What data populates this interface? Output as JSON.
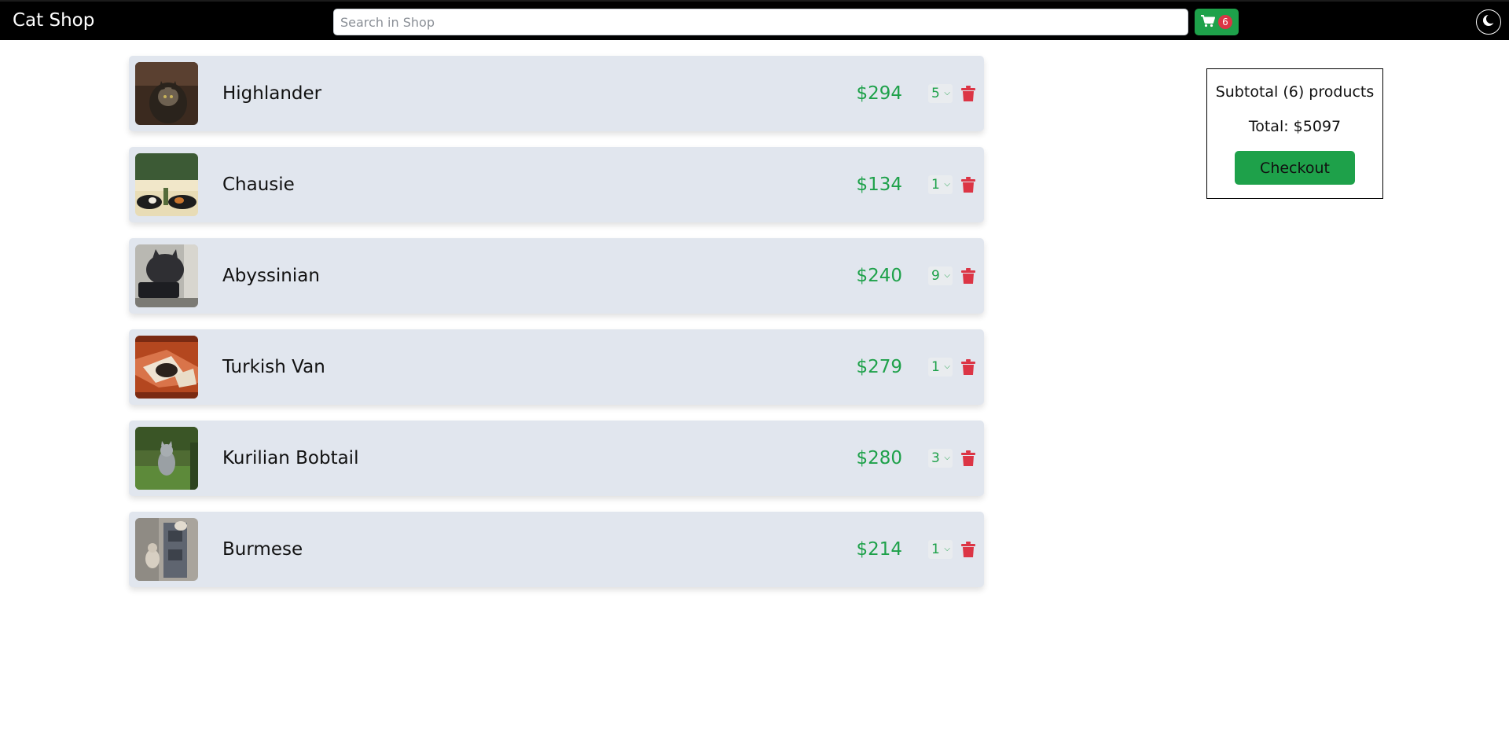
{
  "header": {
    "brand": "Cat Shop",
    "search_placeholder": "Search in Shop",
    "cart_count": "6",
    "cart_icon": "shopping-cart-icon",
    "theme_icon": "moon-icon"
  },
  "cart": {
    "items": [
      {
        "name": "Highlander",
        "price": "$294",
        "qty": "5"
      },
      {
        "name": "Chausie",
        "price": "$134",
        "qty": "1"
      },
      {
        "name": "Abyssinian",
        "price": "$240",
        "qty": "9"
      },
      {
        "name": "Turkish Van",
        "price": "$279",
        "qty": "1"
      },
      {
        "name": "Kurilian Bobtail",
        "price": "$280",
        "qty": "3"
      },
      {
        "name": "Burmese",
        "price": "$214",
        "qty": "1"
      }
    ]
  },
  "summary": {
    "subtotal": "Subtotal (6) products",
    "total": "Total: $5097",
    "checkout_label": "Checkout"
  },
  "colors": {
    "navbar": "#000000",
    "accent_green": "#1ea14a",
    "danger_red": "#dc3545",
    "item_bg": "#e1e6ee"
  }
}
